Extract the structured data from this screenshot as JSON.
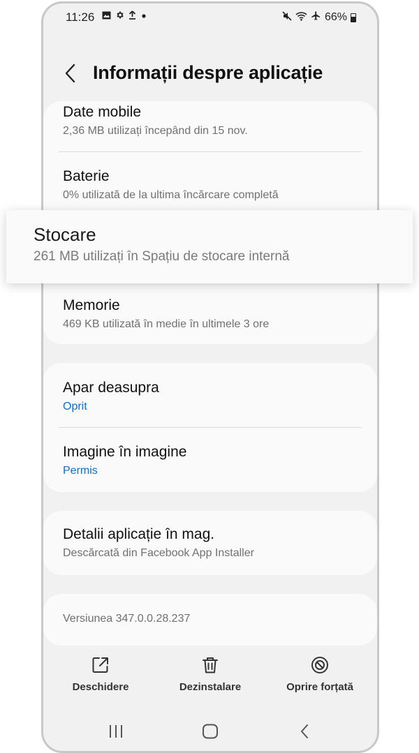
{
  "status_bar": {
    "time": "11:26",
    "left_icons": [
      "image-icon",
      "gear-icon",
      "upload-icon",
      "dot-icon"
    ],
    "right_icons": [
      "mute-icon",
      "wifi-icon",
      "airplane-icon"
    ],
    "battery": "66%"
  },
  "header": {
    "title": "Informații despre aplicație"
  },
  "usage_card": {
    "items": [
      {
        "title": "Date mobile",
        "subtitle": "2,36 MB utilizați începând din 15 nov."
      },
      {
        "title": "Baterie",
        "subtitle": "0% utilizată de la ultima încărcare completă"
      },
      {
        "title": "Stocare",
        "subtitle": "261 MB utilizați în Spațiu de stocare internă"
      },
      {
        "title": "Memorie",
        "subtitle": "469 KB utilizată în medie în ultimele 3 ore"
      }
    ]
  },
  "permissions_card": {
    "items": [
      {
        "title": "Apar deasupra",
        "subtitle": "Oprit"
      },
      {
        "title": "Imagine în imagine",
        "subtitle": "Permis"
      }
    ]
  },
  "store_card": {
    "title": "Detalii aplicație în mag.",
    "subtitle": "Descărcată din Facebook App Installer"
  },
  "version": "Versiunea 347.0.0.28.237",
  "actions": [
    {
      "label": "Deschidere",
      "icon": "open-external-icon"
    },
    {
      "label": "Dezinstalare",
      "icon": "trash-icon"
    },
    {
      "label": "Oprire forțată",
      "icon": "block-icon"
    }
  ],
  "colors": {
    "accent_blue": "#0a6fd0",
    "background": "#f1f1f1",
    "card": "#fafafa"
  }
}
